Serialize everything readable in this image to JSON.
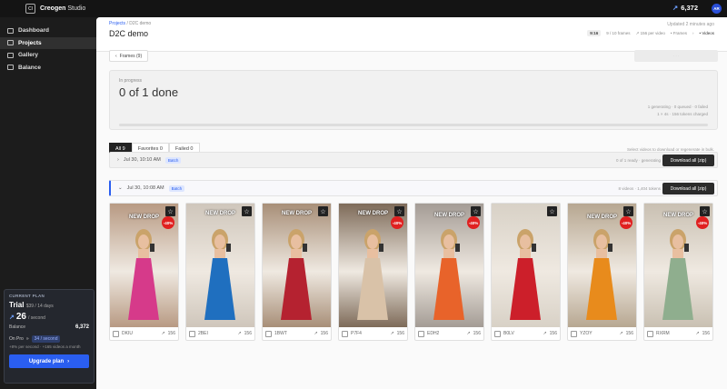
{
  "app": {
    "logo_text": "Cl",
    "brand": "Creogen",
    "brand_suffix": "Studio",
    "credits": "6,372",
    "avatar": "AR"
  },
  "sidebar": {
    "items": [
      {
        "label": "Dashboard"
      },
      {
        "label": "Projects"
      },
      {
        "label": "Gallery"
      },
      {
        "label": "Balance"
      }
    ]
  },
  "plan": {
    "label": "CURRENT PLAN",
    "name": "Trial",
    "price": "$39 / 14 days",
    "rate": "26",
    "rate_unit": "/ second",
    "balance_label": "Balance",
    "balance": "6,372",
    "pro_label": "On Pro",
    "pro_rate": "34 / second",
    "pro_sub": "+8% per second · +165 videos a month",
    "upgrade": "Upgrade plan"
  },
  "header": {
    "crumb_root": "Projects",
    "crumb_sep": "/",
    "crumb_current": "D2C demo",
    "title": "D2C demo",
    "updated": "Updated 2 minutes ago",
    "ratio": "9:16",
    "frames": "9 / 10 frames",
    "per_video": "156 per video",
    "frames_link": "Frames",
    "videos_link": "Videos"
  },
  "toolbar": {
    "frames_btn": "Frames (9)",
    "disabled_btn": "· · ·"
  },
  "progress": {
    "label": "In progress",
    "done_text": "0 of 1 done",
    "status_line1": "1 generating · 0 queued · 0 failed",
    "status_line2": "1 × 4s · 156 tokens charged"
  },
  "tabs": [
    {
      "label": "All 9"
    },
    {
      "label": "Favorites 0"
    },
    {
      "label": "Failed 0"
    }
  ],
  "hint": "Select videos to download or regenerate in bulk.",
  "batches": [
    {
      "date": "Jul 30, 10:10 AM",
      "badge": "Batch",
      "stat": "0 of 1 ready · generating",
      "download": "Download all (zip)"
    },
    {
      "date": "Jul 30, 10:08 AM",
      "badge": "Batch",
      "stat": "8 videos · 1,404 tokens",
      "download": "Download all (zip)"
    }
  ],
  "videos": [
    {
      "id": "DKIU",
      "cost": "156",
      "caption": "NEW DROP",
      "sale": "-40%",
      "color": "#d63a8a",
      "bg": "#b89a83"
    },
    {
      "id": "2BEI",
      "cost": "156",
      "caption": "NEW DROP",
      "sale": "",
      "color": "#1f6fbf",
      "bg": "#cfc6bb"
    },
    {
      "id": "1BWT",
      "cost": "156",
      "caption": "NEW DROP",
      "sale": "",
      "color": "#b52230",
      "bg": "#a88f78"
    },
    {
      "id": "P7F4",
      "cost": "156",
      "caption": "NEW DROP",
      "sale": "-40%",
      "color": "#d9c2a8",
      "bg": "#7e6b59"
    },
    {
      "id": "EDH2",
      "cost": "156",
      "caption": "NEW DROP",
      "sale": "-40%",
      "color": "#e8632a",
      "bg": "#a49c95"
    },
    {
      "id": "B0LV",
      "cost": "156",
      "caption": "",
      "sale": "",
      "color": "#cc1f2a",
      "bg": "#d8d1c6"
    },
    {
      "id": "YZOY",
      "cost": "156",
      "caption": "NEW DROP",
      "sale": "-40%",
      "color": "#e88b1c",
      "bg": "#b7a791"
    },
    {
      "id": "RXRM",
      "cost": "156",
      "caption": "NEW DROP",
      "sale": "-40%",
      "color": "#8fae8e",
      "bg": "#c9c0b2"
    }
  ],
  "icons": {
    "star": "star-icon",
    "bolt": "bolt-icon",
    "chevron": "chevron-icon"
  }
}
